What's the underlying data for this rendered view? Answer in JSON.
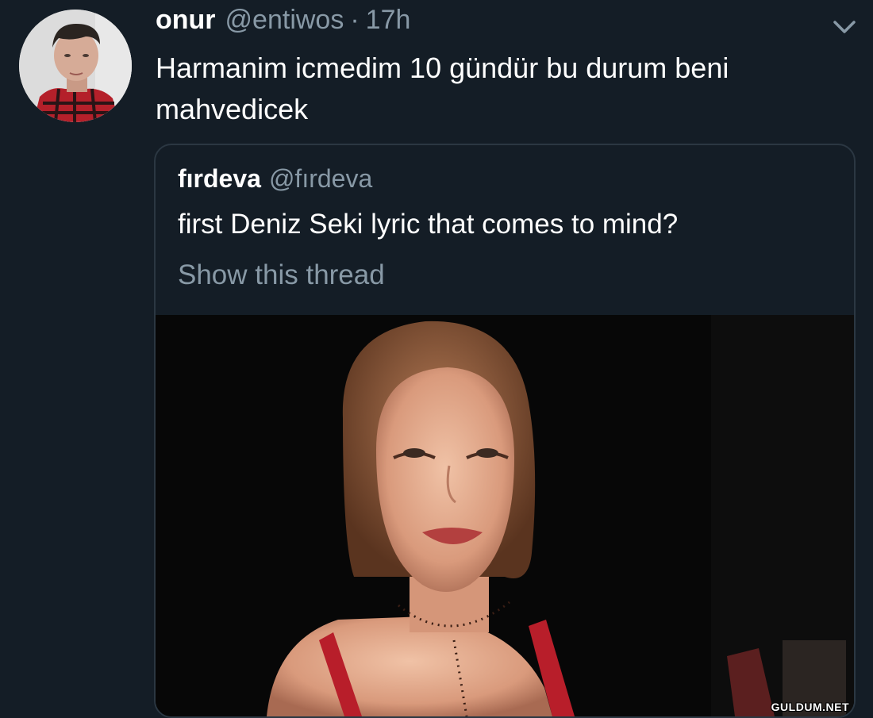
{
  "tweet": {
    "author_name": "onur",
    "author_handle": "@entiwos",
    "separator": "·",
    "time": "17h",
    "text": "Harmanim icmedim 10 gündür bu durum beni mahvedicek",
    "avatar_icon": "user-avatar-icon",
    "menu_icon": "chevron-down-icon"
  },
  "quoted_tweet": {
    "author_name": "fırdeva",
    "author_handle": "@fırdeva",
    "text": "first Deniz Seki lyric that comes to mind?",
    "show_thread_label": "Show this thread",
    "media": "photo"
  },
  "watermark": "GULDUM.NET",
  "colors": {
    "background": "#141d26",
    "text_primary": "#ffffff",
    "text_secondary": "#8899a6",
    "border": "#2b3742"
  }
}
